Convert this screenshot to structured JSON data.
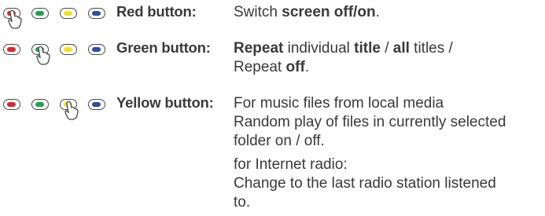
{
  "colors": {
    "red": "#e0242c",
    "green": "#1aa64a",
    "yellow": "#f4e01a",
    "blue": "#2d4da6",
    "text": "#3a3a3a"
  },
  "rows": [
    {
      "label": "Red button:",
      "pressed_key": "red",
      "lines": [
        [
          {
            "t": "Switch ",
            "b": false
          },
          {
            "t": "screen off/on",
            "b": true
          },
          {
            "t": ".",
            "b": false
          }
        ]
      ]
    },
    {
      "label": "Green button:",
      "pressed_key": "green",
      "lines": [
        [
          {
            "t": "Repeat",
            "b": true
          },
          {
            "t": " individual ",
            "b": false
          },
          {
            "t": "title",
            "b": true
          },
          {
            "t": " / ",
            "b": false
          },
          {
            "t": "all",
            "b": true
          },
          {
            "t": " titles /",
            "b": false
          }
        ],
        [
          {
            "t": "Repeat ",
            "b": false
          },
          {
            "t": "off",
            "b": true
          },
          {
            "t": ".",
            "b": false
          }
        ]
      ]
    },
    {
      "label": "Yellow button:",
      "pressed_key": "yellow",
      "lines": [
        [
          {
            "t": "For music files from local media",
            "b": false
          }
        ],
        [
          {
            "t": "Random play of files in currently selected",
            "b": false
          }
        ],
        [
          {
            "t": "folder on / off.",
            "b": false
          }
        ],
        [
          {
            "t": "for Internet radio:",
            "b": false
          }
        ],
        [
          {
            "t": "Change to the last radio station listened",
            "b": false
          }
        ],
        [
          {
            "t": "to.",
            "b": false
          }
        ]
      ]
    }
  ]
}
